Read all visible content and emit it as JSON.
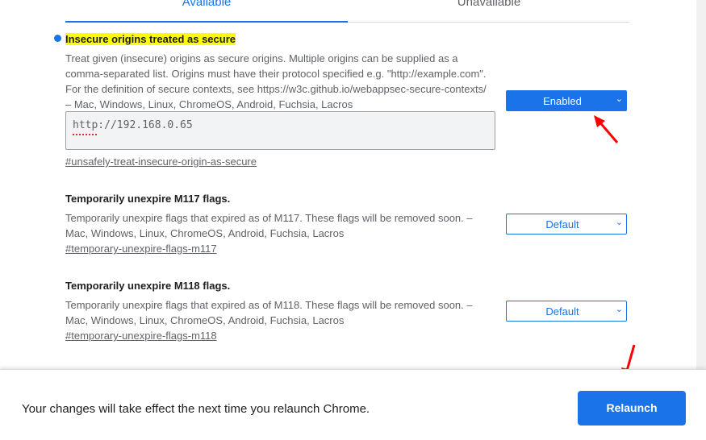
{
  "tabs": {
    "available": "Available",
    "unavailable": "Unavailable"
  },
  "experiments": [
    {
      "title": "Insecure origins treated as secure",
      "description": "Treat given (insecure) origins as secure origins. Multiple origins can be supplied as a comma-separated list. Origins must have their protocol specified e.g. \"http://example.com\". For the definition of secure contexts, see https://w3c.github.io/webappsec-secure-contexts/ – Mac, Windows, Linux, ChromeOS, Android, Fuchsia, Lacros",
      "input_value": "http://192.168.0.65",
      "link": "#unsafely-treat-insecure-origin-as-secure",
      "select_value": "Enabled",
      "modified": true
    },
    {
      "title": "Temporarily unexpire M117 flags.",
      "description": "Temporarily unexpire flags that expired as of M117. These flags will be removed soon. – Mac, Windows, Linux, ChromeOS, Android, Fuchsia, Lacros",
      "link": "#temporary-unexpire-flags-m117",
      "select_value": "Default"
    },
    {
      "title": "Temporarily unexpire M118 flags.",
      "description": "Temporarily unexpire flags that expired as of M118. These flags will be removed soon. – Mac, Windows, Linux, ChromeOS, Android, Fuchsia, Lacros",
      "link": "#temporary-unexpire-flags-m118",
      "select_value": "Default"
    }
  ],
  "bottom_bar": {
    "message": "Your changes will take effect the next time you relaunch Chrome.",
    "relaunch_label": "Relaunch"
  },
  "colors": {
    "accent": "#1a73e8",
    "highlight": "#ffff00",
    "annotation_arrow": "#ff0000"
  },
  "icons": {
    "select_chevron": "chevron-down-icon",
    "modified_marker": "dot-icon",
    "annotation": "red-arrow"
  }
}
